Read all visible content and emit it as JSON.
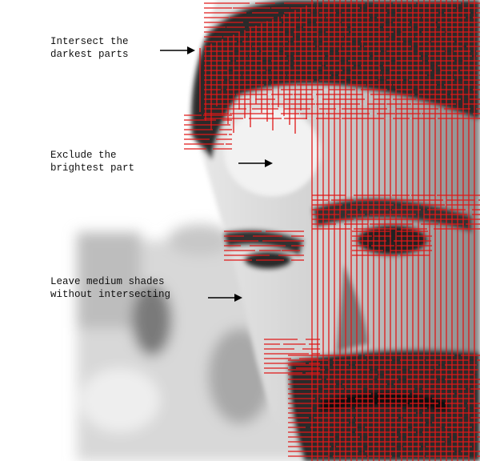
{
  "annotations": [
    {
      "line1": "Intersect the",
      "line2": "darkest parts"
    },
    {
      "line1": "Exclude the",
      "line2": "brightest part"
    },
    {
      "line1": "Leave medium shades",
      "line2": "without intersecting"
    }
  ],
  "colors": {
    "hatch": "#e01818",
    "arrow": "#000000",
    "text": "#111111"
  },
  "icons": [
    "arrow-right-icon",
    "arrow-right-icon",
    "arrow-right-icon"
  ]
}
